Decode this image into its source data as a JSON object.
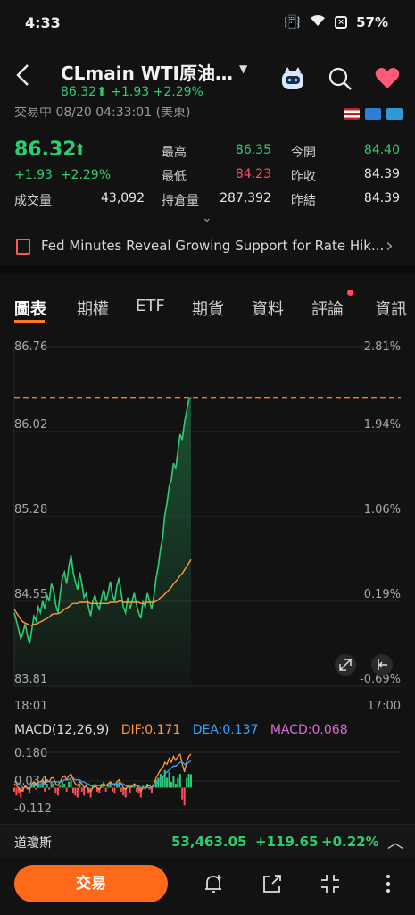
{
  "status_bar": {
    "time": "4:33",
    "battery": "57%"
  },
  "header": {
    "title": "CLmain  WTI原油…",
    "price": "86.32",
    "change": "+1.93",
    "change_pct": "+2.29%"
  },
  "market_status": "交易中  08/20 04:33:01 (美東)",
  "quote": {
    "price": "86.32",
    "change": "+1.93",
    "change_pct": "+2.29%",
    "volume_label": "成交量",
    "volume": "43,092",
    "stats": [
      {
        "label": "最高",
        "value": "86.35",
        "color": "#2ecc71"
      },
      {
        "label": "最低",
        "value": "84.23",
        "color": "#ff4d5a"
      },
      {
        "label": "持倉量",
        "value": "287,392",
        "color": "#e8e8e8"
      },
      {
        "label": "今開",
        "value": "84.40",
        "color": "#2ecc71"
      },
      {
        "label": "昨收",
        "value": "84.39",
        "color": "#e8e8e8"
      },
      {
        "label": "昨結",
        "value": "84.39",
        "color": "#e8e8e8"
      }
    ]
  },
  "news": {
    "headline": "Fed Minutes Reveal Growing Support for Rate Hik..."
  },
  "tabs": [
    "圖表",
    "期權",
    "ETF",
    "期貨",
    "資料",
    "評論",
    "資訊"
  ],
  "chart_data": [
    {
      "type": "line",
      "x_labels": [
        "18:01",
        "17:00"
      ],
      "y_ticks": [
        "86.76",
        "86.02",
        "85.28",
        "84.55",
        "83.81"
      ],
      "y_ticks_right": [
        "2.81%",
        "1.94%",
        "1.06%",
        "0.19%",
        "-0.69%"
      ],
      "ylim": [
        83.81,
        86.76
      ],
      "reference_line": 86.32,
      "series": [
        {
          "values": [
            84.45,
            84.38,
            84.3,
            84.22,
            84.28,
            84.35,
            84.25,
            84.18,
            84.3,
            84.42,
            84.38,
            84.5,
            84.45,
            84.55,
            84.48,
            84.6,
            84.55,
            84.7,
            84.65,
            84.52,
            84.45,
            84.6,
            84.75,
            84.8,
            84.7,
            84.85,
            84.95,
            84.8,
            84.72,
            84.65,
            84.8,
            84.7,
            84.58,
            84.62,
            84.5,
            84.42,
            84.55,
            84.6,
            84.52,
            84.48,
            84.58,
            84.65,
            84.55,
            84.62,
            84.72,
            84.6,
            84.55,
            84.68,
            84.75,
            84.62,
            84.5,
            84.45,
            84.58,
            84.48,
            84.55,
            84.62,
            84.52,
            84.45,
            84.4,
            84.55,
            84.5,
            84.62,
            84.55,
            84.48,
            84.6,
            84.75,
            84.85,
            85.0,
            85.1,
            85.3,
            85.4,
            85.55,
            85.6,
            85.75,
            85.7,
            85.85,
            86.0,
            85.95,
            86.1,
            86.2,
            86.3,
            86.32
          ]
        },
        {
          "values": [
            84.48,
            84.45,
            84.42,
            84.39,
            84.37,
            84.36,
            84.35,
            84.34,
            84.34,
            84.35,
            84.35,
            84.36,
            84.37,
            84.38,
            84.39,
            84.4,
            84.41,
            84.43,
            84.44,
            84.44,
            84.44,
            84.45,
            84.46,
            84.48,
            84.49,
            84.5,
            84.52,
            84.53,
            84.53,
            84.53,
            84.54,
            84.54,
            84.54,
            84.54,
            84.54,
            84.53,
            84.53,
            84.53,
            84.53,
            84.53,
            84.53,
            84.53,
            84.53,
            84.53,
            84.54,
            84.54,
            84.54,
            84.54,
            84.55,
            84.55,
            84.54,
            84.54,
            84.54,
            84.54,
            84.54,
            84.54,
            84.54,
            84.54,
            84.53,
            84.53,
            84.53,
            84.54,
            84.54,
            84.54,
            84.54,
            84.55,
            84.56,
            84.58,
            84.59,
            84.61,
            84.63,
            84.65,
            84.67,
            84.7,
            84.72,
            84.74,
            84.77,
            84.79,
            84.82,
            84.85,
            84.88,
            84.91
          ]
        }
      ]
    },
    {
      "type": "bar",
      "title": "MACD(12,26,9)",
      "labels": {
        "dif": "DIF:0.171",
        "dea": "DEA:0.137",
        "macd": "MACD:0.068"
      },
      "y_ticks": [
        "0.180",
        "0.034",
        "-0.112"
      ],
      "ylim": [
        -0.112,
        0.18
      ],
      "macd": [
        -0.02,
        -0.04,
        -0.03,
        -0.05,
        -0.02,
        0.01,
        -0.01,
        -0.03,
        0.02,
        0.03,
        -0.01,
        0.02,
        0.01,
        0.03,
        -0.02,
        0.02,
        -0.01,
        0.03,
        0.02,
        -0.03,
        -0.04,
        0.01,
        0.03,
        0.02,
        -0.02,
        0.03,
        0.04,
        -0.03,
        -0.04,
        -0.05,
        0.02,
        -0.02,
        -0.04,
        0.01,
        -0.03,
        -0.05,
        0.01,
        0.02,
        -0.02,
        -0.03,
        0.02,
        0.03,
        -0.02,
        0.01,
        0.03,
        -0.02,
        -0.03,
        0.02,
        0.03,
        -0.02,
        -0.04,
        -0.05,
        0.01,
        -0.03,
        0.01,
        0.02,
        -0.02,
        -0.03,
        -0.05,
        0.01,
        -0.01,
        0.02,
        -0.01,
        -0.03,
        0.01,
        0.04,
        0.05,
        0.07,
        0.06,
        0.09,
        0.05,
        0.08,
        0.03,
        0.06,
        0.02,
        0.05,
        0.07,
        -0.06,
        -0.09,
        0.05,
        0.07,
        0.068
      ],
      "dif": [
        0.02,
        0.01,
        0.0,
        -0.02,
        -0.01,
        0.01,
        0.0,
        -0.01,
        0.02,
        0.03,
        0.02,
        0.03,
        0.03,
        0.04,
        0.02,
        0.04,
        0.03,
        0.05,
        0.05,
        0.02,
        0.01,
        0.03,
        0.05,
        0.06,
        0.04,
        0.06,
        0.07,
        0.04,
        0.02,
        0.01,
        0.03,
        0.02,
        0.0,
        0.01,
        -0.01,
        -0.02,
        0.0,
        0.01,
        0.0,
        -0.01,
        0.01,
        0.02,
        0.01,
        0.02,
        0.03,
        0.02,
        0.01,
        0.03,
        0.04,
        0.02,
        0.0,
        -0.01,
        0.01,
        0.0,
        0.01,
        0.02,
        0.01,
        0.0,
        -0.02,
        0.0,
        0.0,
        0.01,
        0.01,
        0.0,
        0.02,
        0.05,
        0.07,
        0.09,
        0.1,
        0.13,
        0.12,
        0.15,
        0.13,
        0.16,
        0.14,
        0.16,
        0.17,
        0.12,
        0.08,
        0.13,
        0.16,
        0.171
      ],
      "dea": [
        0.03,
        0.03,
        0.02,
        0.01,
        0.0,
        0.0,
        0.0,
        0.0,
        0.01,
        0.01,
        0.01,
        0.02,
        0.02,
        0.02,
        0.02,
        0.03,
        0.03,
        0.03,
        0.03,
        0.03,
        0.03,
        0.03,
        0.03,
        0.04,
        0.04,
        0.04,
        0.05,
        0.05,
        0.04,
        0.04,
        0.04,
        0.03,
        0.03,
        0.02,
        0.02,
        0.01,
        0.01,
        0.01,
        0.01,
        0.01,
        0.01,
        0.01,
        0.01,
        0.01,
        0.02,
        0.02,
        0.02,
        0.02,
        0.02,
        0.02,
        0.02,
        0.01,
        0.01,
        0.01,
        0.01,
        0.01,
        0.01,
        0.01,
        0.0,
        0.0,
        0.0,
        0.0,
        0.0,
        0.0,
        0.01,
        0.02,
        0.03,
        0.04,
        0.05,
        0.07,
        0.08,
        0.09,
        0.1,
        0.11,
        0.11,
        0.12,
        0.13,
        0.13,
        0.12,
        0.12,
        0.13,
        0.137
      ]
    }
  ],
  "index_ticker": {
    "name": "道瓊斯",
    "value": "53,463.05",
    "change": "+119.65",
    "change_pct": "+0.22%"
  },
  "bottom_bar": {
    "trade_label": "交易"
  },
  "colors": {
    "accent": "#ff6a1a",
    "up": "#2ecc71",
    "down": "#ff4d5a",
    "dif": "#ff9a3c",
    "dea": "#3aa0ff",
    "macd": "#d86bd8"
  }
}
